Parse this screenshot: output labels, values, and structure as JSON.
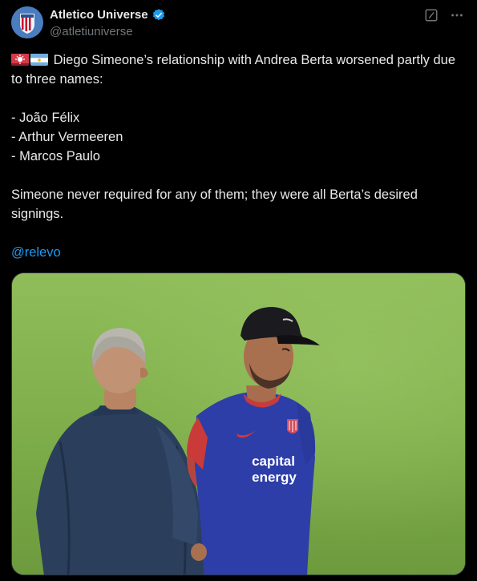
{
  "header": {
    "display_name": "Atletico Universe",
    "handle": "@atletiuniverse",
    "verified_icon": "verified-badge-icon",
    "grok_icon": "grok-icon",
    "more_icon": "more-options-icon"
  },
  "tweet": {
    "line1": "Diego Simeone’s relationship with Andrea Berta worsened partly due to three names:",
    "items": [
      "- João Félix",
      "- Arthur Vermeeren",
      "- Marcos Paulo"
    ],
    "line2": "Simeone never required for any of them; they were all Berta’s desired signings.",
    "mention": "@relevo"
  },
  "media": {
    "shirt_text_1": "capital",
    "shirt_text_2": "energy"
  },
  "colors": {
    "background": "#000000",
    "text": "#e7e9ea",
    "muted": "#71767b",
    "link": "#1d9bf0",
    "grass": "#86b352"
  }
}
